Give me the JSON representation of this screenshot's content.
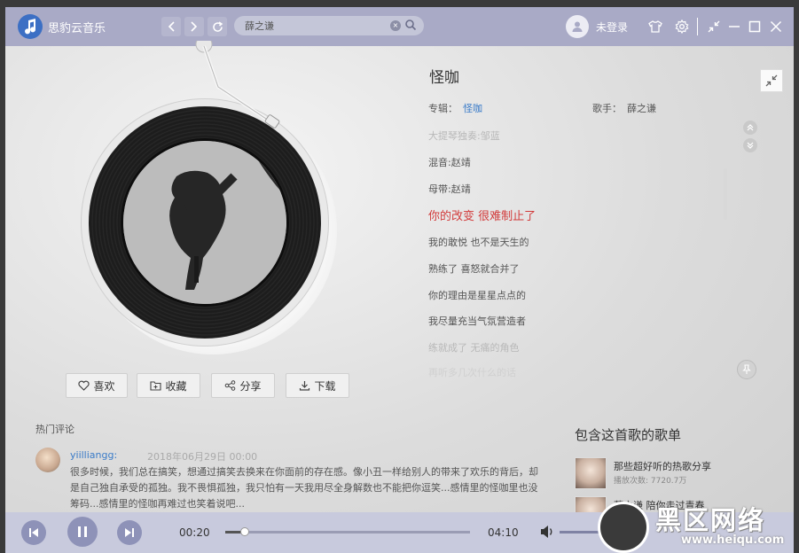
{
  "app": {
    "name": "思豹云音乐"
  },
  "titlebar": {
    "search_value": "薛之谦",
    "user_label": "未登录"
  },
  "song": {
    "title": "怪咖",
    "album_label": "专辑：",
    "album": "怪咖",
    "artist_label": "歌手：",
    "artist": "薛之谦"
  },
  "lyrics": [
    {
      "text": "大提琴独奏:邹蓝",
      "state": "faded"
    },
    {
      "text": "混音:赵靖",
      "state": "normal"
    },
    {
      "text": "母带:赵靖",
      "state": "normal"
    },
    {
      "text": "你的改变 很难制止了",
      "state": "current"
    },
    {
      "text": "我的敢悦 也不是天生的",
      "state": "normal"
    },
    {
      "text": "熟练了 喜怒就合并了",
      "state": "normal"
    },
    {
      "text": "你的理由是星星点点的",
      "state": "normal"
    },
    {
      "text": "我尽量充当气氛营造者",
      "state": "normal"
    },
    {
      "text": "练就成了 无痛的角色",
      "state": "faded"
    },
    {
      "text": "再听多几次什么的话",
      "state": "faded"
    }
  ],
  "actions": {
    "like": "喜欢",
    "collect": "收藏",
    "share": "分享",
    "download": "下载"
  },
  "comments": {
    "heading": "热门评论",
    "items": [
      {
        "user": "yiilliangg:",
        "time": "2018年06月29日 00:00",
        "text": "很多时候，我们总在搞笑，想通过搞笑去换来在你面前的存在感。像小丑一样给别人的带来了欢乐的背后，却是自己独自承受的孤独。我不畏惧孤独，我只怕有一天我用尽全身解数也不能把你逗笑...感情里的怪咖里也没筹码...感情里的怪咖再难过也笑着说吧..."
      }
    ]
  },
  "playlists": {
    "heading": "包含这首歌的歌单",
    "items": [
      {
        "name": "那些超好听的热歌分享",
        "plays": "播放次数: 7720.7万"
      },
      {
        "name": "薛之谦 陪你走过青春",
        "plays": ""
      }
    ]
  },
  "player": {
    "elapsed": "00:20",
    "duration": "04:10",
    "progress": 0.08
  },
  "watermark": {
    "text": "黑区网络",
    "url": "www.heiqu.com"
  },
  "colors": {
    "titlebar": "#a9aac6",
    "accent_link": "#3a7bc8",
    "current_lyric": "#d23b3b",
    "player_button": "#8e92b8"
  }
}
